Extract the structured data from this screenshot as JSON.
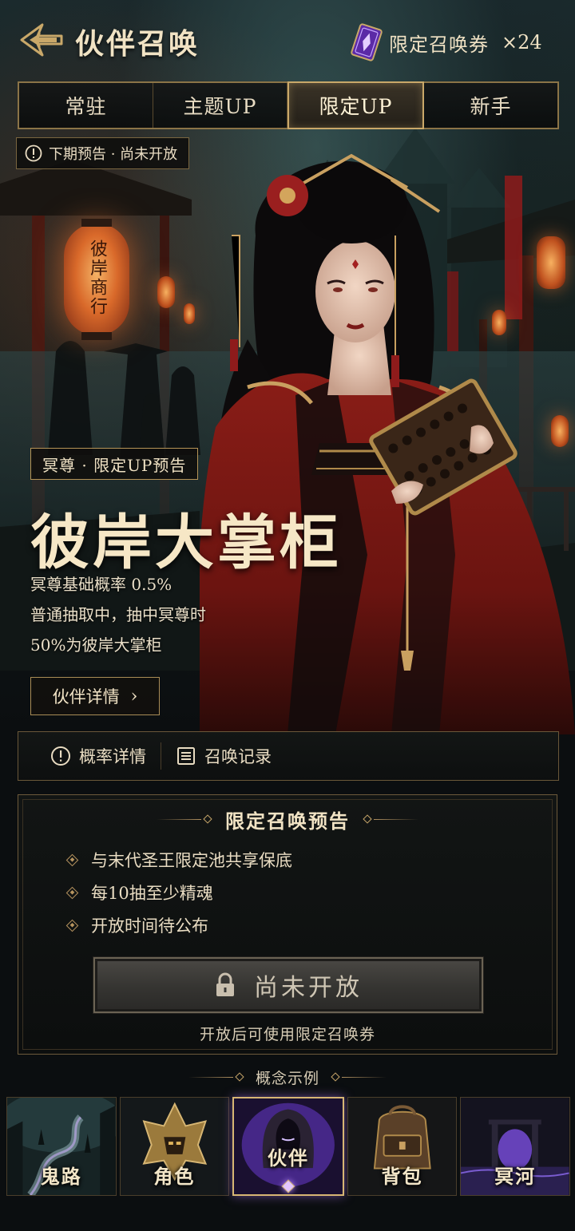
{
  "header": {
    "title": "伙伴召唤",
    "ticket_label": "限定召唤券",
    "ticket_count": "×24"
  },
  "tabs": [
    {
      "label": "常驻",
      "active": false
    },
    {
      "label": "主题UP",
      "active": false
    },
    {
      "label": "限定UP",
      "active": true
    },
    {
      "label": "新手",
      "active": false
    }
  ],
  "notice": {
    "text": "下期预告 · 尚未开放",
    "icon": "info-circle-icon"
  },
  "lantern_text": "彼岸商行",
  "hero": {
    "badge": "冥尊 · 限定UP预告",
    "name": "彼岸大掌柜",
    "desc_lines": [
      "冥尊基础概率 0.5%",
      "普通抽取中，抽中冥尊时",
      "50%为彼岸大掌柜"
    ],
    "detail_button": "伙伴详情",
    "detail_chevron": "›"
  },
  "info_bar": {
    "rates_label": "概率详情",
    "records_label": "召唤记录"
  },
  "preview": {
    "title": "限定召唤预告",
    "bullets": [
      "与末代圣王限定池共享保底",
      "每10抽至少精魂",
      "开放时间待公布"
    ],
    "locked_button": "尚未开放",
    "hint": "开放后可使用限定召唤券"
  },
  "concept_label": "概念示例",
  "bottom_nav": [
    {
      "label": "鬼路",
      "active": false
    },
    {
      "label": "角色",
      "active": false
    },
    {
      "label": "伙伴",
      "active": true
    },
    {
      "label": "背包",
      "active": false
    },
    {
      "label": "冥河",
      "active": false
    }
  ],
  "colors": {
    "gold": "#c9a869",
    "accent_purple": "#8a4fe0",
    "crimson": "#8e1b1b",
    "background": "#0b0e10"
  }
}
